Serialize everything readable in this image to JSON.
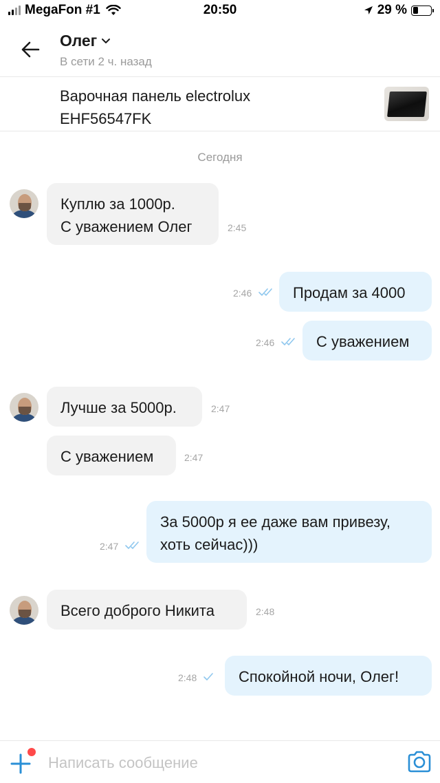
{
  "status_bar": {
    "carrier": "MegaFon #1",
    "time": "20:50",
    "battery_percent": "29 %",
    "battery_level": 0.29
  },
  "header": {
    "contact_name": "Олег",
    "contact_status": "В сети 2 ч. назад"
  },
  "item": {
    "title": "Варочная панель electrolux EHF56547FK"
  },
  "chat": {
    "date_separator": "Сегодня",
    "messages": [
      {
        "direction": "in",
        "lines": [
          "Куплю за 1000р.",
          "С уважением Олег"
        ],
        "time": "2:45"
      },
      {
        "direction": "out",
        "lines": [
          "Продам за 4000"
        ],
        "time": "2:46",
        "status": "read"
      },
      {
        "direction": "out",
        "lines": [
          "С уважением"
        ],
        "time": "2:46",
        "status": "read"
      },
      {
        "direction": "in",
        "lines": [
          "Лучше за 5000р."
        ],
        "time": "2:47"
      },
      {
        "direction": "in",
        "lines": [
          "С уважением"
        ],
        "time": "2:47"
      },
      {
        "direction": "out",
        "lines": [
          "За 5000р я ее даже вам привезу,",
          "хоть сейчас)))"
        ],
        "time": "2:47",
        "status": "read"
      },
      {
        "direction": "in",
        "lines": [
          "Всего доброго Никита"
        ],
        "time": "2:48"
      },
      {
        "direction": "out",
        "lines": [
          "Спокойной ночи, Олег!"
        ],
        "time": "2:48",
        "status": "delivered"
      }
    ]
  },
  "composer": {
    "placeholder": "Написать сообщение",
    "value": ""
  },
  "colors": {
    "accent": "#2a8fd6",
    "outgoing_bubble": "#e4f3fd",
    "incoming_bubble": "#f2f2f2",
    "notification_badge": "#ff4a4a"
  },
  "icons": [
    "signal-icon",
    "wifi-icon",
    "location-arrow-icon",
    "battery-icon",
    "back-arrow-icon",
    "chevron-down-icon",
    "double-check-icon",
    "single-check-icon",
    "add-icon",
    "camera-icon"
  ]
}
